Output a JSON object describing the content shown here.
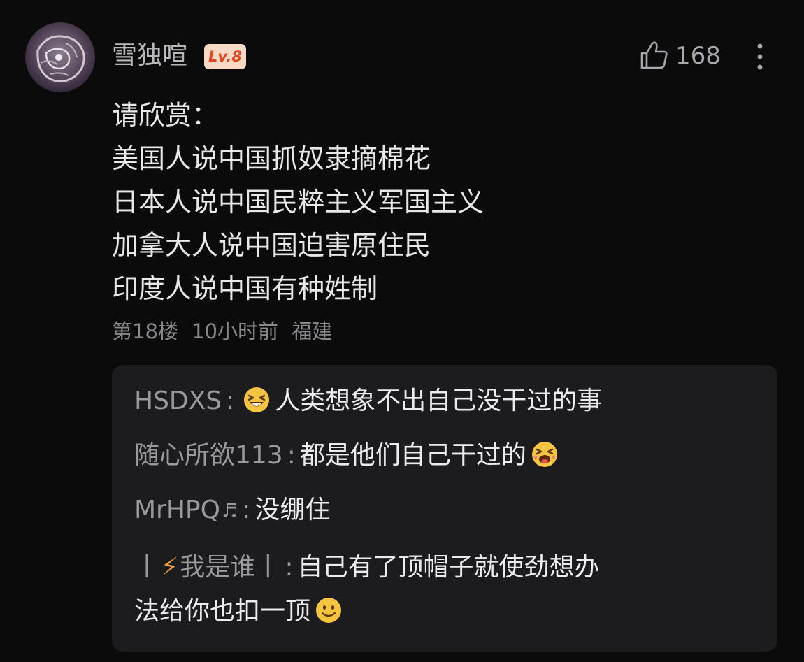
{
  "comment": {
    "username": "雪独喧",
    "level": "Lv.8",
    "like_icon": "thumbs-up-icon",
    "like_count": "168",
    "more_icon": "more-vertical-icon",
    "content_lines": [
      "请欣赏：",
      "美国人说中国抓奴隶摘棉花",
      "日本人说中国民粹主义军国主义",
      "加拿大人说中国迫害原住民",
      "印度人说中国有种姓制"
    ],
    "floor": "第18楼",
    "time": "10小时前",
    "location": "福建"
  },
  "replies": [
    {
      "author": "HSDXS",
      "separator": ":",
      "emoji_before": "laughing-emoji",
      "text": "人类想象不出自己没干过的事"
    },
    {
      "author": "随心所欲113",
      "separator": ":",
      "text": "都是他们自己干过的",
      "emoji_after": "grinning-squint-emoji"
    },
    {
      "author": "MrHPQ",
      "author_suffix_icon": "music-note-icon",
      "separator": ":",
      "text": "没绷住"
    },
    {
      "author_prefix": "丨",
      "author_icon": "lightning-icon",
      "author": "我是谁",
      "author_suffix": "丨",
      "separator": ":",
      "text": "自己有了顶帽子就使劲想办",
      "text_continued": "法给你也扣一顶",
      "emoji_after": "smile-emoji"
    }
  ],
  "colors": {
    "background": "#0b0b0c",
    "reply_box": "#1c1c1e",
    "badge_bg": "#f8d9c6",
    "badge_text": "#e2471d",
    "emoji_yellow": "#f5c542"
  }
}
